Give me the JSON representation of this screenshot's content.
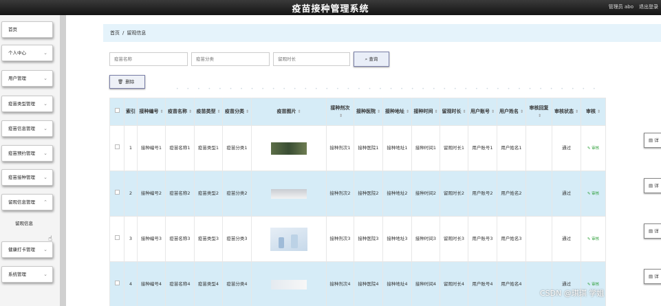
{
  "header": {
    "title": "疫苗接种管理系统",
    "user": "管理员 abo",
    "logout": "退出登录"
  },
  "sidebar": {
    "items": [
      {
        "label": "首页",
        "has_chevron": false
      },
      {
        "label": "个人中心",
        "has_chevron": true
      },
      {
        "label": "用户管理",
        "has_chevron": true
      },
      {
        "label": "疫苗类型管理",
        "has_chevron": true
      },
      {
        "label": "疫苗信息管理",
        "has_chevron": true
      },
      {
        "label": "疫苗预约管理",
        "has_chevron": true
      },
      {
        "label": "疫苗接种管理",
        "has_chevron": true
      },
      {
        "label": "留观信息管理",
        "has_chevron": true
      },
      {
        "label": "健康打卡管理",
        "has_chevron": true
      },
      {
        "label": "系统管理",
        "has_chevron": true
      }
    ],
    "sub_item": "留观信息"
  },
  "breadcrumb": {
    "home": "首页",
    "separator": "/",
    "current": "留观信息"
  },
  "search": {
    "name_placeholder": "疫苗名称",
    "type_placeholder": "疫苗分类",
    "duration_placeholder": "留观时长",
    "button_label": "查询",
    "search_icon": "search-icon"
  },
  "toolbar": {
    "delete_label": "删除",
    "delete_icon": "trash-icon"
  },
  "table": {
    "headers": [
      "索引",
      "接种编号",
      "疫苗名称",
      "疫苗类型",
      "疫苗分类",
      "疫苗图片",
      "接种剂次",
      "接种医院",
      "接种地址",
      "接种时间",
      "留观时长",
      "用户账号",
      "用户姓名",
      "审核回复",
      "审核状态",
      "审核"
    ],
    "rows": [
      {
        "index": "1",
        "code": "接种编号1",
        "name": "疫苗名称1",
        "type": "疫苗类型1",
        "category": "疫苗分类1",
        "dose": "接种剂次1",
        "hospital": "接种医院1",
        "address": "接种地址1",
        "time": "接种时间1",
        "duration": "留观时长1",
        "account": "用户账号1",
        "username": "用户姓名1",
        "reply": "",
        "status": "通过",
        "review": "审核",
        "detail": "详"
      },
      {
        "index": "2",
        "code": "接种编号2",
        "name": "疫苗名称2",
        "type": "疫苗类型2",
        "category": "疫苗分类2",
        "dose": "接种剂次2",
        "hospital": "接种医院2",
        "address": "接种地址2",
        "time": "接种时间2",
        "duration": "留观时长2",
        "account": "用户账号2",
        "username": "用户姓名2",
        "reply": "",
        "status": "通过",
        "review": "审核",
        "detail": "详"
      },
      {
        "index": "3",
        "code": "接种编号3",
        "name": "疫苗名称3",
        "type": "疫苗类型3",
        "category": "疫苗分类3",
        "dose": "接种剂次3",
        "hospital": "接种医院3",
        "address": "接种地址3",
        "time": "接种时间3",
        "duration": "留观时长3",
        "account": "用户账号3",
        "username": "用户姓名3",
        "reply": "",
        "status": "通过",
        "review": "审核",
        "detail": "详"
      },
      {
        "index": "4",
        "code": "接种编号4",
        "name": "疫苗名称4",
        "type": "疫苗类型4",
        "category": "疫苗分类4",
        "dose": "接种剂次4",
        "hospital": "接种医院4",
        "address": "接种地址4",
        "time": "接种时间4",
        "duration": "留观时长4",
        "account": "用户账号4",
        "username": "用户姓名4",
        "reply": "",
        "status": "通过",
        "review": "审核",
        "detail": "详"
      }
    ]
  },
  "watermark": "CSDN @琪琪 学姐",
  "colors": {
    "header_bg": "#1f1f1f",
    "table_header": "#d6ecf7",
    "breadcrumb_bg": "#e5f3fb",
    "approve": "#2e9f3a"
  }
}
